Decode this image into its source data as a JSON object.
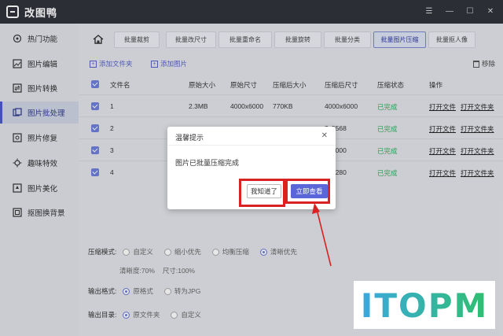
{
  "app": {
    "title": "改图鸭"
  },
  "sidebar": {
    "items": [
      {
        "label": "热门功能",
        "icon": "hot-icon"
      },
      {
        "label": "图片编辑",
        "icon": "image-edit-icon"
      },
      {
        "label": "图片转换",
        "icon": "convert-icon"
      },
      {
        "label": "图片批处理",
        "icon": "batch-icon",
        "active": true
      },
      {
        "label": "照片修复",
        "icon": "repair-icon"
      },
      {
        "label": "趣味特效",
        "icon": "effects-icon"
      },
      {
        "label": "图片美化",
        "icon": "beautify-icon"
      },
      {
        "label": "抠图换背景",
        "icon": "cutout-icon"
      }
    ]
  },
  "tabs": [
    "批量裁剪",
    "批量改尺寸",
    "批量重命名",
    "批量旋转",
    "批量分类",
    "批量图片压缩",
    "批量抠人像"
  ],
  "toolbar": {
    "add_folder": "添加文件夹",
    "add_image": "添加图片",
    "remove": "移除"
  },
  "table": {
    "headers": [
      "文件名",
      "原始大小",
      "原始尺寸",
      "压缩后大小",
      "压缩后尺寸",
      "压缩状态",
      "操作"
    ],
    "rows": [
      {
        "name": "1",
        "orig_size": "2.3MB",
        "orig_dim": "4000x6000",
        "new_size": "770KB",
        "new_dim": "4000x6000",
        "status": "已完成",
        "op1": "打开文件",
        "op2": "打开文件夹"
      },
      {
        "name": "2",
        "orig_size": "",
        "orig_dim": "",
        "new_size": "",
        "new_dim": "2x5568",
        "status": "已完成",
        "op1": "打开文件",
        "op2": "打开文件夹"
      },
      {
        "name": "3",
        "orig_size": "",
        "orig_dim": "",
        "new_size": "",
        "new_dim": "0x4000",
        "status": "已完成",
        "op1": "打开文件",
        "op2": "打开文件夹"
      },
      {
        "name": "4",
        "orig_size": "",
        "orig_dim": "",
        "new_size": "",
        "new_dim": "0x1280",
        "status": "已完成",
        "op1": "打开文件",
        "op2": "打开文件夹"
      }
    ]
  },
  "settings": {
    "mode_label": "压缩模式:",
    "modes": [
      "自定义",
      "缩小优先",
      "均衡压缩",
      "清晰优先"
    ],
    "mode_selected": 3,
    "quality": "清晰度:70%",
    "size": "尺寸:100%",
    "format_label": "输出格式:",
    "formats": [
      "原格式",
      "转为JPG"
    ],
    "format_selected": 0,
    "dir_label": "输出目录:",
    "dirs": [
      "原文件夹",
      "自定义"
    ],
    "dir_selected": 0
  },
  "dialog": {
    "title": "温馨提示",
    "message": "图片已批量压缩完成",
    "btn_know": "我知道了",
    "btn_view": "立即查看"
  },
  "watermark": {
    "text": "ITOPM"
  },
  "colors": {
    "accent": "#5b67d9",
    "success": "#2fae5a",
    "highlight": "#d92323",
    "titlebar": "#2f3239"
  }
}
